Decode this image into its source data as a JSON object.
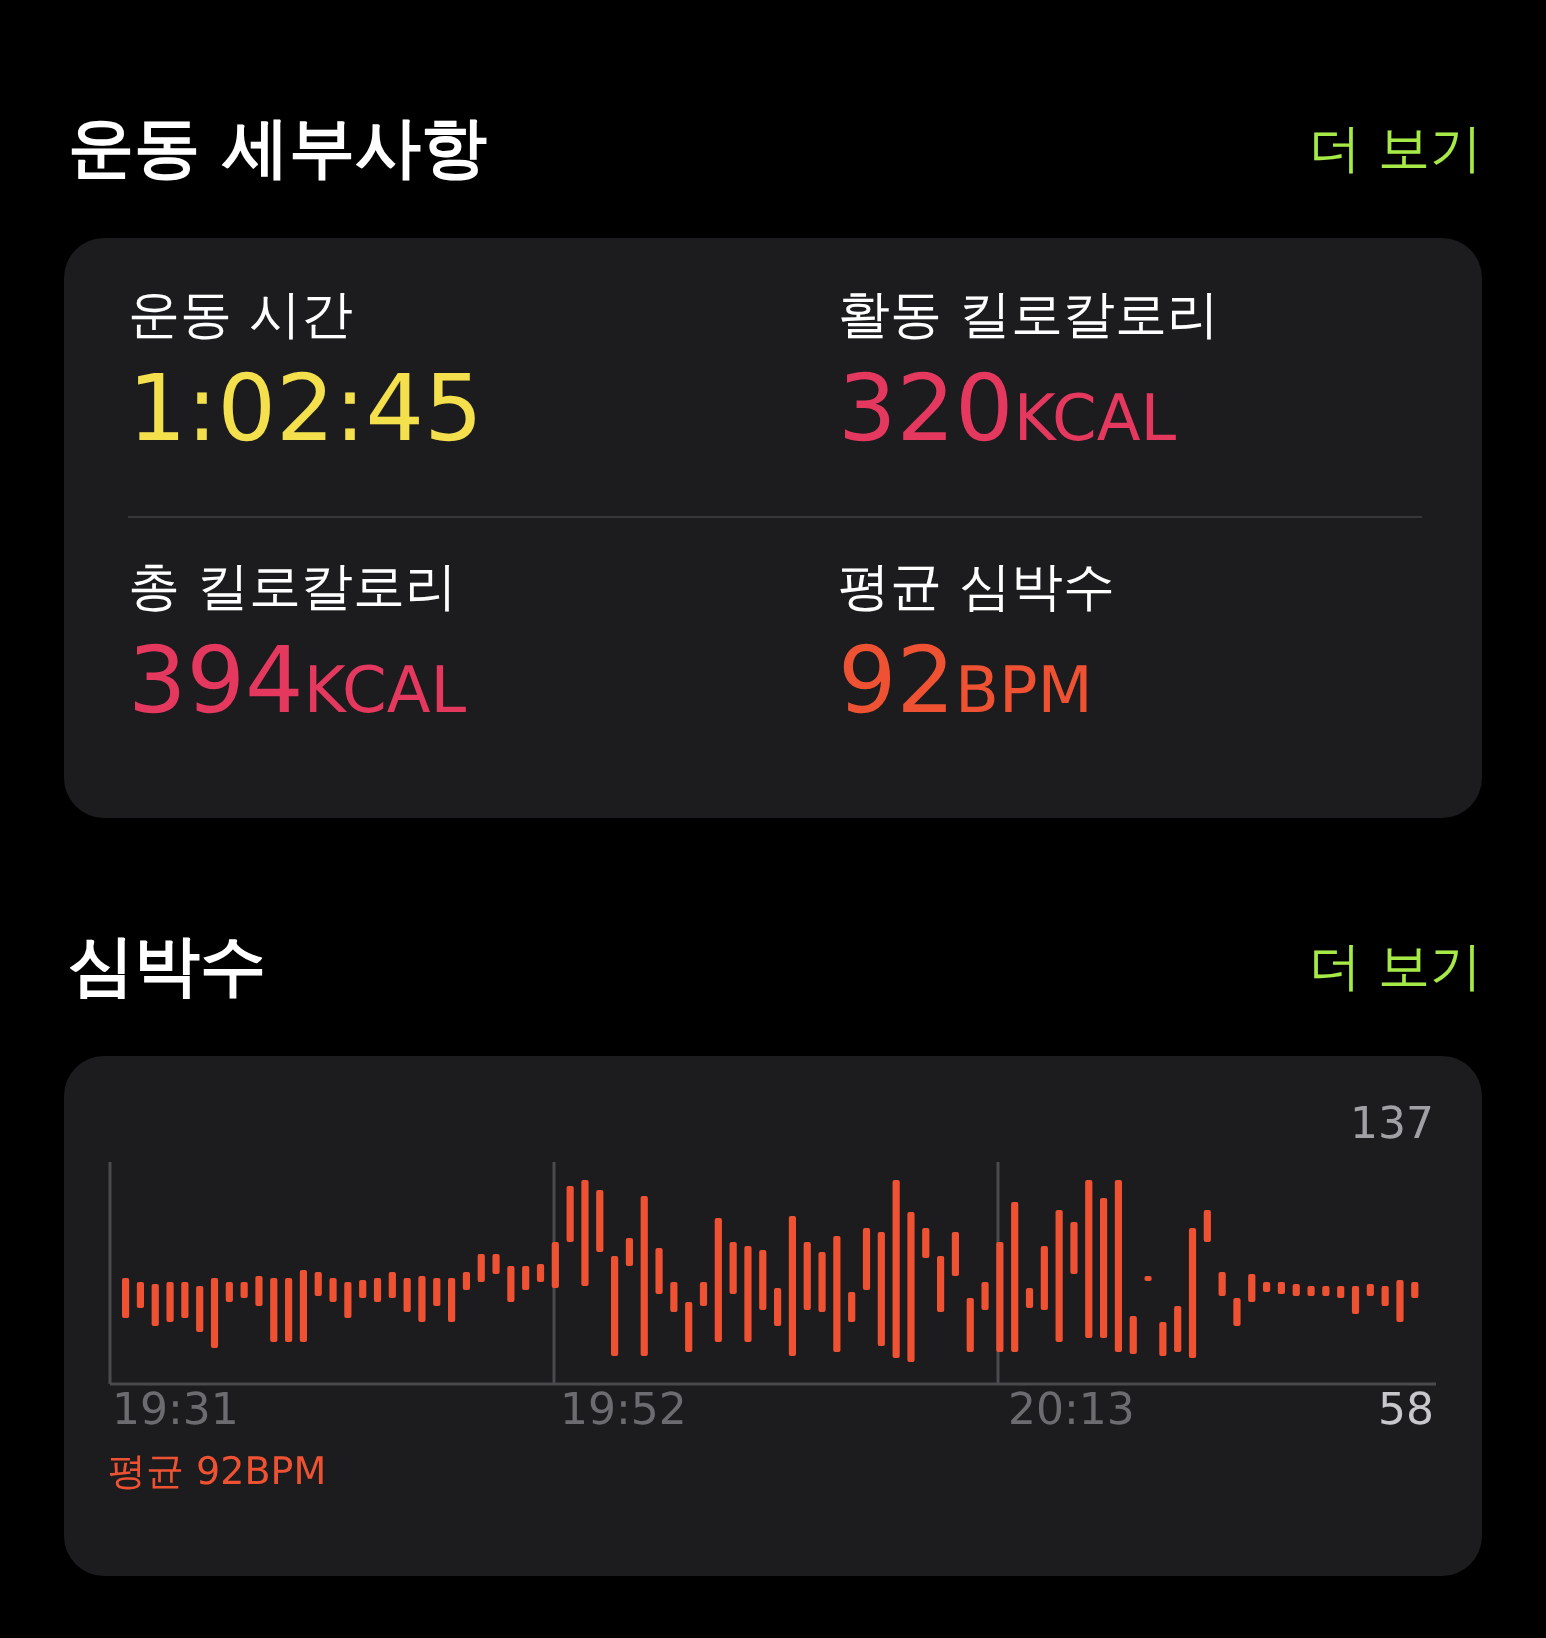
{
  "workout_details": {
    "title": "운동 세부사항",
    "more_link": "더 보기",
    "metrics": [
      {
        "label": "운동 시간",
        "value": "1:02:45",
        "color": "#f4e04d"
      },
      {
        "label": "활동 킬로칼로리",
        "value": "320",
        "unit": "KCAL",
        "color": "#e5385e"
      },
      {
        "label": "총 킬로칼로리",
        "value": "394",
        "unit": "KCAL",
        "color": "#e5385e"
      },
      {
        "label": "평균 심박수",
        "value": "92",
        "unit": "BPM",
        "color": "#ef5232"
      }
    ]
  },
  "heart_rate": {
    "title": "심박수",
    "more_link": "더 보기",
    "max_label": "137",
    "min_label": "58",
    "time_labels": [
      "19:31",
      "19:52",
      "20:13"
    ],
    "average": "평균 92BPM"
  }
}
